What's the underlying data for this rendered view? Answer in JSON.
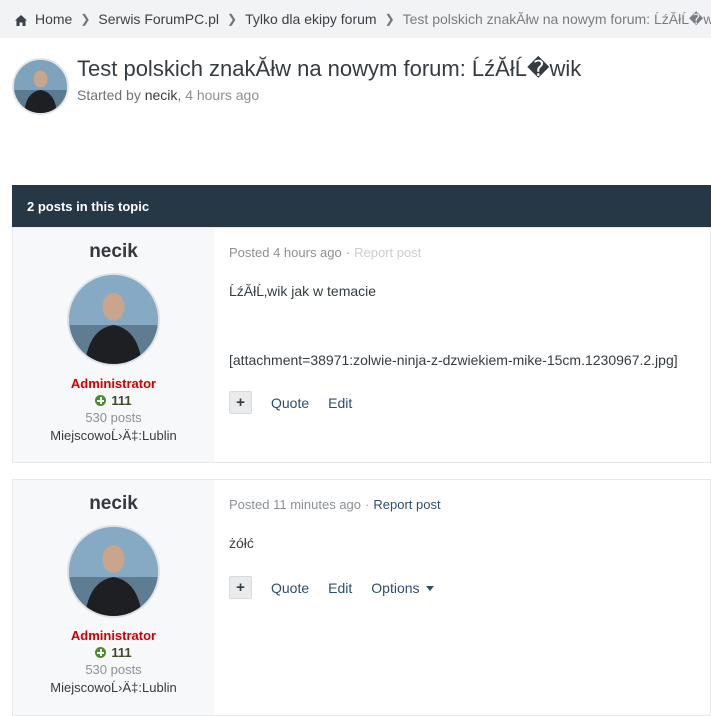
{
  "breadcrumb": {
    "items": [
      {
        "label": "Home",
        "icon": "home-icon"
      },
      {
        "label": "Serwis ForumPC.pl"
      },
      {
        "label": "Tylko dla ekipy forum"
      },
      {
        "label": "Test polskich znakĂłw na nowym forum: ĹźĂłĹ�wik"
      }
    ]
  },
  "topic": {
    "title": "Test polskich znakĂłw na nowym forum: ĹźĂłĹ�wik",
    "started_by": "Started by",
    "author": "necik",
    "comma": ",",
    "time": "4 hours ago"
  },
  "posts_bar": {
    "label": "2 posts in this topic"
  },
  "posts": [
    {
      "author": "necik",
      "role": "Administrator",
      "reputation": "111",
      "post_count": "530 posts",
      "location": "MiejscowoĹ›Ä‡:Lublin",
      "posted": "Posted 4 hours ago",
      "meta_sep": "·",
      "report": "Report post",
      "body": "ĹźĂłĹ‚wik jak w temacie",
      "attachment": "[attachment=38971:zolwie-ninja-z-dzwiekiem-mike-15cm.1230967.2.jpg]",
      "multiquote": "+",
      "quote": "Quote",
      "edit": "Edit"
    },
    {
      "author": "necik",
      "role": "Administrator",
      "reputation": "111",
      "post_count": "530 posts",
      "location": "MiejscowoĹ›Ä‡:Lublin",
      "posted": "Posted 11 minutes ago",
      "meta_sep": "·",
      "report": "Report post",
      "body": "żółć",
      "multiquote": "+",
      "quote": "Quote",
      "edit": "Edit",
      "options": "Options"
    }
  ],
  "colors": {
    "header_bar": "#263746",
    "role": "#d10000",
    "link": "#2e4e6e",
    "reputation_positive": "#4a8c2a"
  }
}
